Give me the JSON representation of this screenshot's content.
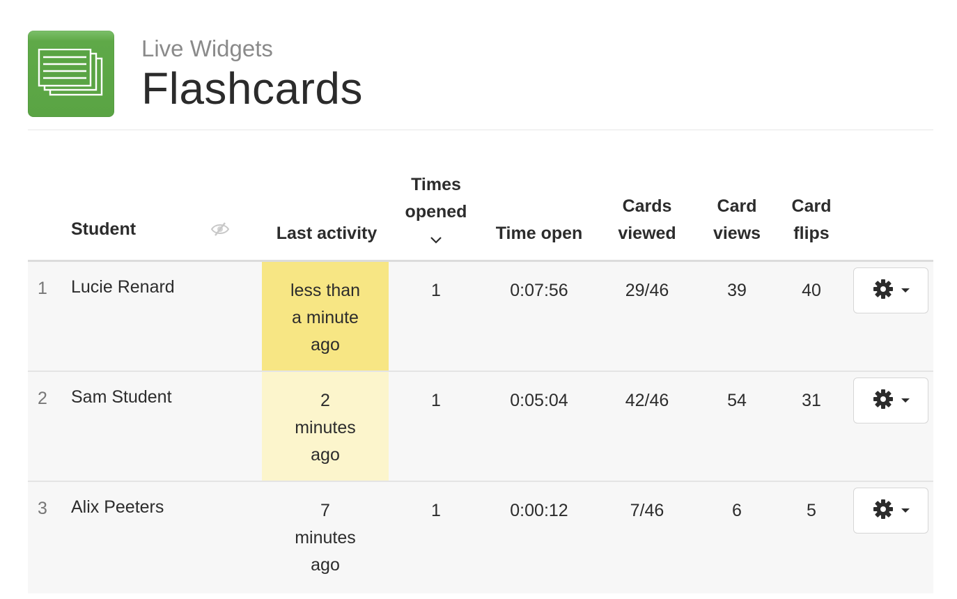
{
  "header": {
    "subtitle": "Live Widgets",
    "title": "Flashcards",
    "logo_icon": "flashcards-icon"
  },
  "table": {
    "columns": {
      "student": "Student",
      "last_activity": "Last activity",
      "times_opened_1": "Times",
      "times_opened_2": "opened",
      "time_open": "Time open",
      "cards_viewed_1": "Cards",
      "cards_viewed_2": "viewed",
      "card_views_1": "Card",
      "card_views_2": "views",
      "card_flips_1": "Card",
      "card_flips_2": "flips"
    },
    "rows": [
      {
        "num": "1",
        "name": "Lucie Renard",
        "last_activity": [
          "less than",
          "a minute",
          "ago"
        ],
        "times_opened": "1",
        "time_open": "0:07:56",
        "cards_viewed": "29/46",
        "card_views": "39",
        "card_flips": "40"
      },
      {
        "num": "2",
        "name": "Sam Student",
        "last_activity": [
          "2",
          "minutes",
          "ago"
        ],
        "times_opened": "1",
        "time_open": "0:05:04",
        "cards_viewed": "42/46",
        "card_views": "54",
        "card_flips": "31"
      },
      {
        "num": "3",
        "name": "Alix Peeters",
        "last_activity": [
          "7",
          "minutes",
          "ago"
        ],
        "times_opened": "1",
        "time_open": "0:00:12",
        "cards_viewed": "7/46",
        "card_views": "6",
        "card_flips": "5"
      }
    ]
  },
  "colors": {
    "logo_green": "#5aa444",
    "highlight_recent": "#f7e684",
    "highlight_older": "#fcf5cc",
    "row_background": "#f7f7f7"
  },
  "icons": {
    "hide_names": "eye-slash-icon",
    "sort": "chevron-down-icon",
    "row_menu": "gear-icon"
  }
}
